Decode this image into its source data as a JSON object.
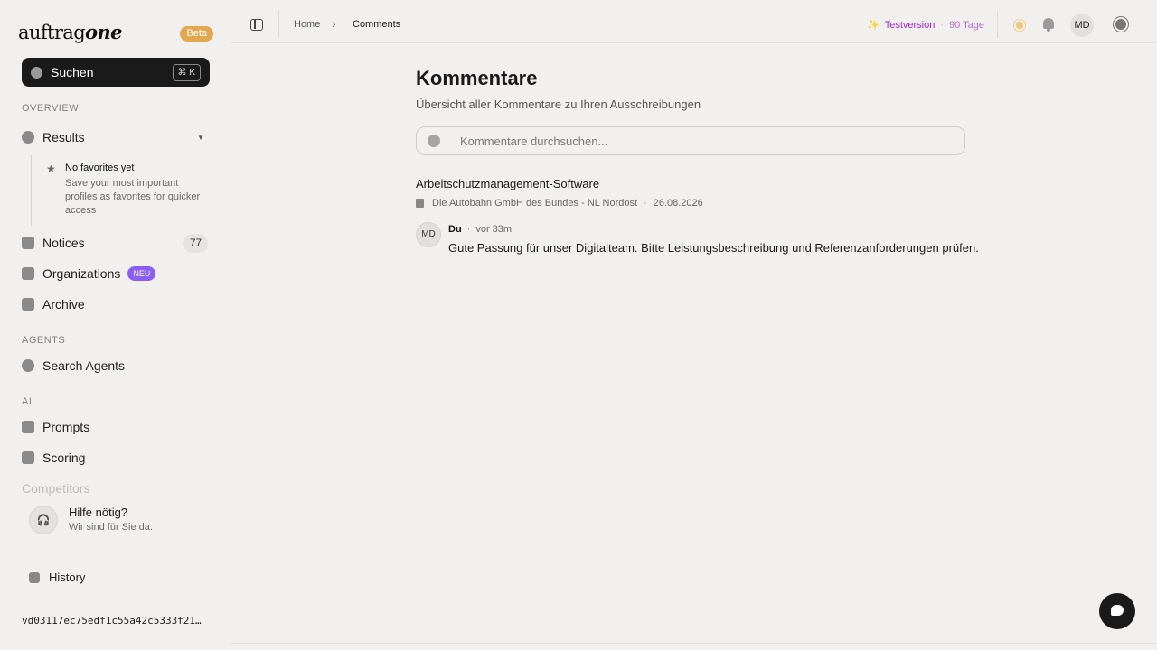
{
  "brand": {
    "name_prefix": "auftrag",
    "name_suffix": "one",
    "beta_label": "Beta"
  },
  "sidebar": {
    "search_label": "Suchen",
    "search_shortcut": "⌘ K",
    "sections": {
      "overview": "OVERVIEW",
      "agents": "AGENTS",
      "ai": "AI"
    },
    "results_label": "Results",
    "favorites": {
      "title": "No favorites yet",
      "description": "Save your most important profiles as favorites for quicker access"
    },
    "notices_label": "Notices",
    "notices_count": "77",
    "organizations_label": "Organizations",
    "organizations_badge": "NEU",
    "archive_label": "Archive",
    "search_agents_label": "Search Agents",
    "prompts_label": "Prompts",
    "scoring_label": "Scoring",
    "faded_label": "Competitors",
    "help": {
      "title": "Hilfe nötig?",
      "subtitle": "Wir sind für Sie da."
    },
    "history_label": "History",
    "version_hash": "vd03117ec75edf1c55a42c5333f21…"
  },
  "header": {
    "breadcrumb": [
      "Home",
      "Comments"
    ],
    "trial_label": "Testversion",
    "trial_days": "90 Tage",
    "user_initials": "MD"
  },
  "main": {
    "title": "Kommentare",
    "subtitle": "Übersicht aller Kommentare zu Ihren Ausschreibungen",
    "search_placeholder": "Kommentare durchsuchen...",
    "entries": [
      {
        "title": "Arbeitschutzmanagement-Software",
        "organization": "Die Autobahn GmbH des Bundes - NL Nordost",
        "date": "26.08.2026",
        "comment": {
          "initials": "MD",
          "author": "Du",
          "time": "vor 33m",
          "text": "Gute Passung für unser Digitalteam. Bitte Leistungsbeschreibung und Referenzanforderungen prüfen."
        }
      }
    ]
  }
}
